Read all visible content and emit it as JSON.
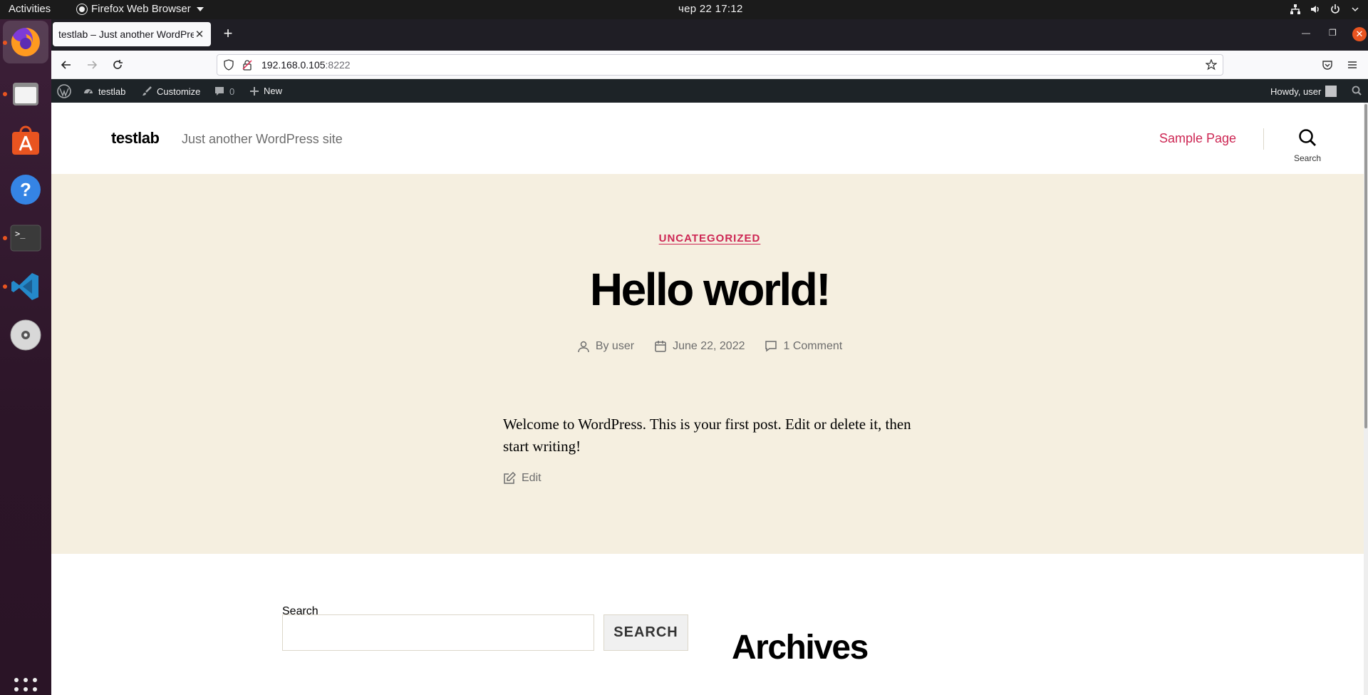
{
  "os_topbar": {
    "activities": "Activities",
    "app_name": "Firefox Web Browser",
    "clock": "чер 22  17:12"
  },
  "dock": {
    "items": [
      "firefox-icon",
      "files-icon",
      "app-store-icon",
      "help-icon",
      "terminal-icon",
      "vscode-icon",
      "disc-icon"
    ],
    "show_apps": "grid-icon"
  },
  "browser": {
    "tab_title": "testlab – Just another WordPress site",
    "url_host": "192.168.0.105",
    "url_port": ":8222"
  },
  "admin_bar": {
    "site": "testlab",
    "customize": "Customize",
    "comments_count": "0",
    "new": "New",
    "howdy": "Howdy, user"
  },
  "site": {
    "title": "testlab",
    "description": "Just another WordPress site",
    "menu_item": "Sample Page",
    "search_label": "Search"
  },
  "post": {
    "category": "UNCATEGORIZED",
    "title": "Hello world!",
    "author": "By user",
    "date": "June 22, 2022",
    "comments": "1 Comment",
    "content": "Welcome to WordPress. This is your first post. Edit or delete it, then start writing!",
    "edit": "Edit"
  },
  "widgets": {
    "search_label": "Search",
    "search_button": "SEARCH",
    "archives_title": "Archives"
  },
  "colors": {
    "accent": "#cd2653",
    "hero_bg": "#f5efe0",
    "adminbar_bg": "#1d2327",
    "ubuntu_orange": "#e95420"
  }
}
